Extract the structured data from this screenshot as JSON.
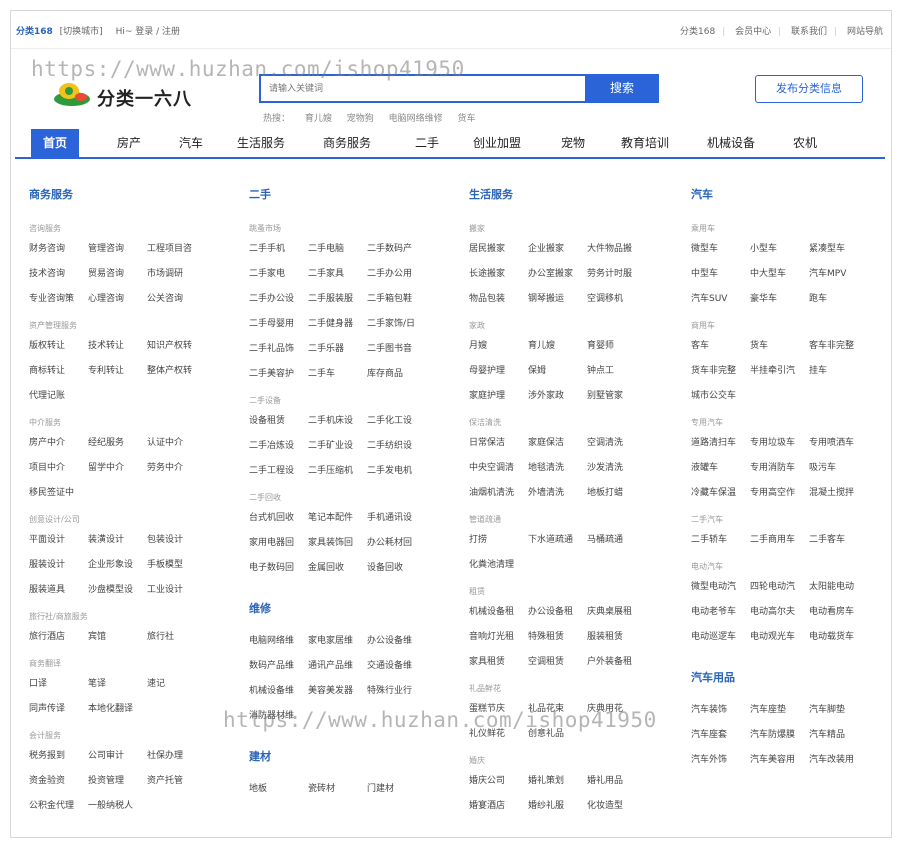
{
  "topbar": {
    "brand": "分类168",
    "switch_city": "[切换城市]",
    "greeting": "Hi~ 登录 / 注册",
    "right_links": [
      "分类168",
      "会员中心",
      "联系我们",
      "网站导航"
    ]
  },
  "watermark": "https://www.huzhan.com/ishop41950",
  "logo": {
    "text": "分类一六八"
  },
  "search": {
    "placeholder": "请输入关键词",
    "button": "搜索",
    "hot_label": "热搜：",
    "hot_words": [
      "育儿嫂",
      "宠物狗",
      "电脑网络维修",
      "货车"
    ]
  },
  "publish_button": "发布分类信息",
  "nav": [
    "首页",
    "房产",
    "汽车",
    "生活服务",
    "商务服务",
    "二手",
    "创业加盟",
    "宠物",
    "教育培训",
    "机械设备",
    "农机"
  ],
  "columns": [
    {
      "title": "商务服务",
      "groups": [
        {
          "name": "咨询服务",
          "rows": [
            [
              "财务咨询",
              "管理咨询",
              "工程项目咨"
            ],
            [
              "技术咨询",
              "贸易咨询",
              "市场调研"
            ],
            [
              "专业咨询策",
              "心理咨询",
              "公关咨询"
            ]
          ]
        },
        {
          "name": "资产管理服务",
          "rows": [
            [
              "版权转让",
              "技术转让",
              "知识产权转"
            ],
            [
              "商标转让",
              "专利转让",
              "整体产权转"
            ],
            [
              "代理记账"
            ]
          ]
        },
        {
          "name": "中介服务",
          "rows": [
            [
              "房产中介",
              "经纪服务",
              "认证中介"
            ],
            [
              "项目中介",
              "留学中介",
              "劳务中介"
            ],
            [
              "移民签证中"
            ]
          ]
        },
        {
          "name": "创意设计/公司",
          "rows": [
            [
              "平面设计",
              "装潢设计",
              "包装设计"
            ],
            [
              "服装设计",
              "企业形象设",
              "手板模型"
            ],
            [
              "服装道具",
              "沙盘模型设",
              "工业设计"
            ]
          ]
        },
        {
          "name": "旅行社/商旅服务",
          "rows": [
            [
              "旅行酒店",
              "宾馆",
              "旅行社"
            ]
          ]
        },
        {
          "name": "商务翻译",
          "rows": [
            [
              "口译",
              "笔译",
              "速记"
            ],
            [
              "同声传译",
              "本地化翻译"
            ]
          ]
        },
        {
          "name": "会计服务",
          "rows": [
            [
              "税务报到",
              "公司审计",
              "社保办理"
            ],
            [
              "资金验资",
              "投资管理",
              "资产托管"
            ],
            [
              "公积金代理",
              "一般纳税人"
            ]
          ]
        }
      ]
    },
    {
      "title": "二手",
      "groups": [
        {
          "name": "跳蚤市场",
          "rows": [
            [
              "二手手机",
              "二手电脑",
              "二手数码产"
            ],
            [
              "二手家电",
              "二手家具",
              "二手办公用"
            ],
            [
              "二手办公设",
              "二手服装服",
              "二手箱包鞋"
            ],
            [
              "二手母婴用",
              "二手健身器",
              "二手家饰/日"
            ],
            [
              "二手礼品饰",
              "二手乐器",
              "二手图书音"
            ],
            [
              "二手美容护",
              "二手车",
              "库存商品"
            ]
          ]
        },
        {
          "name": "二手设备",
          "rows": [
            [
              "设备租赁",
              "二手机床设",
              "二手化工设"
            ],
            [
              "二手冶炼设",
              "二手矿业设",
              "二手纺织设"
            ],
            [
              "二手工程设",
              "二手压缩机",
              "二手发电机"
            ]
          ]
        },
        {
          "name": "二手回收",
          "rows": [
            [
              "台式机回收",
              "笔记本配件",
              "手机通讯设"
            ],
            [
              "家用电器回",
              "家具装饰回",
              "办公耗材回"
            ],
            [
              "电子数码回",
              "金属回收",
              "设备回收"
            ]
          ]
        },
        {
          "title2": "维修",
          "rows": [
            [
              "电脑网络维",
              "家电家居维",
              "办公设备维"
            ],
            [
              "数码产品维",
              "通讯产品维",
              "交通设备维"
            ],
            [
              "机械设备维",
              "美容美发器",
              "特殊行业行"
            ],
            [
              "消防器材维"
            ]
          ]
        },
        {
          "title2": "建材",
          "rows": [
            [
              "地板",
              "瓷砖材",
              "门建材"
            ]
          ]
        }
      ]
    },
    {
      "title": "生活服务",
      "groups": [
        {
          "name": "搬家",
          "rows": [
            [
              "居民搬家",
              "企业搬家",
              "大件物品搬"
            ],
            [
              "长途搬家",
              "办公室搬家",
              "劳务计时服"
            ],
            [
              "物品包装",
              "钢琴搬运",
              "空调移机"
            ]
          ]
        },
        {
          "name": "家政",
          "rows": [
            [
              "月嫂",
              "育儿嫂",
              "育婴师"
            ],
            [
              "母婴护理",
              "保姆",
              "钟点工"
            ],
            [
              "家庭护理",
              "涉外家政",
              "别墅管家"
            ]
          ]
        },
        {
          "name": "保洁清洗",
          "rows": [
            [
              "日常保洁",
              "家庭保洁",
              "空调清洗"
            ],
            [
              "中央空调清",
              "地毯清洗",
              "沙发清洗"
            ],
            [
              "油烟机清洗",
              "外墙清洗",
              "地板打蜡"
            ]
          ]
        },
        {
          "name": "管道疏通",
          "rows": [
            [
              "打捞",
              "下水道疏通",
              "马桶疏通"
            ],
            [
              "化粪池清理"
            ]
          ]
        },
        {
          "name": "租赁",
          "rows": [
            [
              "机械设备租",
              "办公设备租",
              "庆典桌展租"
            ],
            [
              "音响灯光租",
              "特殊租赁",
              "服装租赁"
            ],
            [
              "家具租赁",
              "空调租赁",
              "户外装备租"
            ]
          ]
        },
        {
          "name": "礼品鲜花",
          "rows": [
            [
              "蛋糕节庆",
              "礼品花束",
              "庆典用花"
            ],
            [
              "礼仪鲜花",
              "创意礼品"
            ]
          ]
        },
        {
          "name": "婚庆",
          "rows": [
            [
              "婚庆公司",
              "婚礼策划",
              "婚礼用品"
            ],
            [
              "婚宴酒店",
              "婚纱礼服",
              "化妆造型"
            ]
          ]
        }
      ]
    },
    {
      "title": "汽车",
      "groups": [
        {
          "name": "乘用车",
          "rows": [
            [
              "微型车",
              "小型车",
              "紧凑型车"
            ],
            [
              "中型车",
              "中大型车",
              "汽车MPV"
            ],
            [
              "汽车SUV",
              "豪华车",
              "跑车"
            ]
          ]
        },
        {
          "name": "商用车",
          "rows": [
            [
              "客车",
              "货车",
              "客车非完整"
            ],
            [
              "货车非完整",
              "半挂牵引汽",
              "挂车"
            ],
            [
              "城市公交车"
            ]
          ]
        },
        {
          "name": "专用汽车",
          "rows": [
            [
              "道路清扫车",
              "专用垃圾车",
              "专用喷洒车"
            ],
            [
              "液罐车",
              "专用消防车",
              "吸污车"
            ],
            [
              "冷藏车保温",
              "专用高空作",
              "混凝土搅拌"
            ]
          ]
        },
        {
          "name": "二手汽车",
          "rows": [
            [
              "二手轿车",
              "二手商用车",
              "二手客车"
            ]
          ]
        },
        {
          "name": "电动汽车",
          "rows": [
            [
              "微型电动汽",
              "四轮电动汽",
              "太阳能电动"
            ],
            [
              "电动老爷车",
              "电动高尔夫",
              "电动看房车"
            ],
            [
              "电动巡逻车",
              "电动观光车",
              "电动载货车"
            ]
          ]
        },
        {
          "title2": "汽车用品",
          "rows": [
            [
              "汽车装饰",
              "汽车座垫",
              "汽车脚垫"
            ],
            [
              "汽车座套",
              "汽车防爆膜",
              "汽车精品"
            ],
            [
              "汽车外饰",
              "汽车美容用",
              "汽车改装用"
            ]
          ]
        }
      ]
    }
  ]
}
